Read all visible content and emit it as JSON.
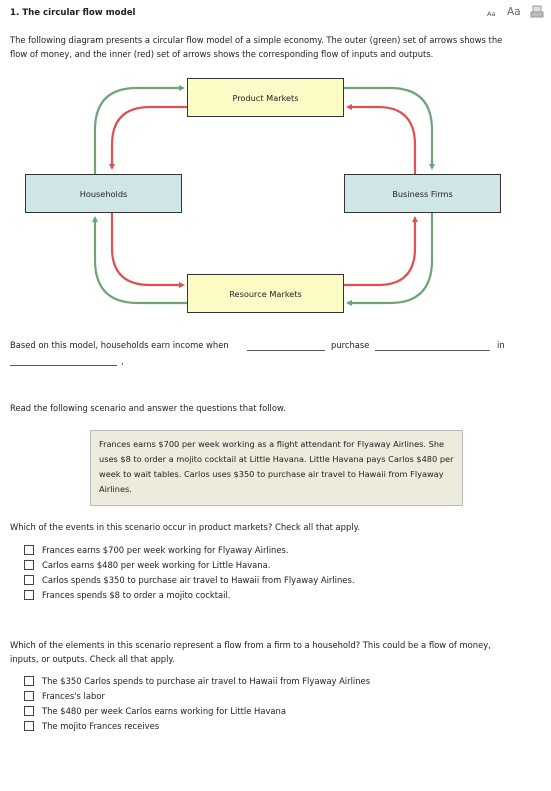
{
  "header": {
    "title": "1.  The circular flow model",
    "font_small_label": "Aa",
    "font_large_label": "Aa",
    "print_icon": "print-icon"
  },
  "intro": [
    "The following diagram presents a circular flow model of a simple economy. The outer (green) set of arrows shows the",
    "flow of money, and the inner (red) set of arrows shows the corresponding flow of inputs and outputs."
  ],
  "diagram": {
    "product_markets": "Product Markets",
    "households": "Households",
    "business_firms": "Business Firms",
    "resource_markets": "Resource Markets",
    "money_color": "#6fa37a",
    "goods_color": "#e05050"
  },
  "fill_in": {
    "part1": "Based on this model, households earn income when",
    "part2": "purchase",
    "part3": "in",
    "end": ",",
    "blank1": "",
    "blank2": "",
    "blank3": ""
  },
  "scenario_prompt": "Read the following scenario and answer the questions that follow.",
  "scenario": "Frances earns $700 per week working as a flight attendant for Flyaway Airlines. She uses $8 to order a mojito cocktail at Little Havana. Little Havana pays Carlos $480 per week to wait tables. Carlos uses $350 to purchase air travel to Hawaii from Flyaway Airlines.",
  "q1": {
    "prompt": "Which of the events in this scenario occur in product markets? Check all that apply.",
    "options": [
      {
        "label": "Frances earns $700 per week working for Flyaway Airlines.",
        "checked": false
      },
      {
        "label": "Carlos earns $480 per week working for Little Havana.",
        "checked": false
      },
      {
        "label": "Carlos spends $350 to purchase air travel to Hawaii from Flyaway Airlines.",
        "checked": false
      },
      {
        "label": "Frances spends $8 to order a mojito cocktail.",
        "checked": false
      }
    ]
  },
  "q2": {
    "prompt": [
      "Which of the elements in this scenario represent a flow from a firm to a household? This could be a flow of money,",
      "inputs, or outputs. Check all that apply."
    ],
    "options": [
      {
        "label": "The $350 Carlos spends to purchase air travel to Hawaii from Flyaway Airlines",
        "checked": false
      },
      {
        "label": "Frances's labor",
        "checked": false
      },
      {
        "label": "The $480 per week Carlos earns working for Little Havana",
        "checked": false
      },
      {
        "label": "The mojito Frances receives",
        "checked": false
      }
    ]
  }
}
